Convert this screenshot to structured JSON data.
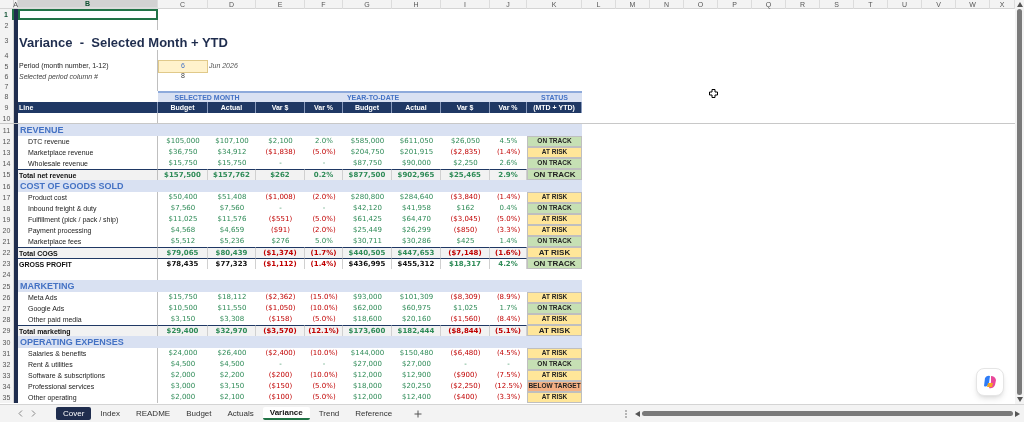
{
  "column_headers": [
    {
      "label": "A",
      "selected": false
    },
    {
      "label": "B",
      "selected": true
    },
    {
      "label": "C",
      "selected": false
    },
    {
      "label": "D",
      "selected": false
    },
    {
      "label": "E",
      "selected": false
    },
    {
      "label": "F",
      "selected": false
    },
    {
      "label": "G",
      "selected": false
    },
    {
      "label": "H",
      "selected": false
    },
    {
      "label": "I",
      "selected": false
    },
    {
      "label": "J",
      "selected": false
    },
    {
      "label": "K",
      "selected": false
    },
    {
      "label": "L",
      "selected": false
    },
    {
      "label": "M",
      "selected": false
    },
    {
      "label": "N",
      "selected": false
    },
    {
      "label": "O",
      "selected": false
    },
    {
      "label": "P",
      "selected": false
    },
    {
      "label": "Q",
      "selected": false
    },
    {
      "label": "R",
      "selected": false
    },
    {
      "label": "S",
      "selected": false
    },
    {
      "label": "T",
      "selected": false
    },
    {
      "label": "U",
      "selected": false
    },
    {
      "label": "V",
      "selected": false
    },
    {
      "label": "W",
      "selected": false
    },
    {
      "label": "X",
      "selected": false
    }
  ],
  "row_headers": [
    {
      "label": "1",
      "selected": true
    },
    {
      "label": "2",
      "selected": false
    },
    {
      "label": "3",
      "selected": false
    },
    {
      "label": "4",
      "selected": false
    },
    {
      "label": "5",
      "selected": false
    },
    {
      "label": "6",
      "selected": false
    },
    {
      "label": "7",
      "selected": false
    },
    {
      "label": "8",
      "selected": false
    },
    {
      "label": "9",
      "selected": false
    },
    {
      "label": "10",
      "selected": false
    },
    {
      "label": "11",
      "selected": false
    },
    {
      "label": "12",
      "selected": false
    },
    {
      "label": "13",
      "selected": false
    },
    {
      "label": "14",
      "selected": false
    },
    {
      "label": "15",
      "selected": false
    },
    {
      "label": "16",
      "selected": false
    },
    {
      "label": "17",
      "selected": false
    },
    {
      "label": "18",
      "selected": false
    },
    {
      "label": "19",
      "selected": false
    },
    {
      "label": "20",
      "selected": false
    },
    {
      "label": "21",
      "selected": false
    },
    {
      "label": "22",
      "selected": false
    },
    {
      "label": "23",
      "selected": false
    },
    {
      "label": "24",
      "selected": false
    },
    {
      "label": "25",
      "selected": false
    },
    {
      "label": "26",
      "selected": false
    },
    {
      "label": "27",
      "selected": false
    },
    {
      "label": "28",
      "selected": false
    },
    {
      "label": "29",
      "selected": false
    },
    {
      "label": "30",
      "selected": false
    },
    {
      "label": "31",
      "selected": false
    },
    {
      "label": "32",
      "selected": false
    },
    {
      "label": "33",
      "selected": false
    },
    {
      "label": "34",
      "selected": false
    },
    {
      "label": "35",
      "selected": false
    }
  ],
  "title": "Variance  -  Selected Month + YTD",
  "period": {
    "label": "Period (month number, 1-12)",
    "value": "6",
    "month": "Jun 2026"
  },
  "selected_column": {
    "label": "Selected period column #",
    "value": "8"
  },
  "group_headers": [
    "SELECTED MONTH",
    "YEAR-TO-DATE",
    "STATUS"
  ],
  "columns": [
    "Line",
    "Budget",
    "Actual",
    "Var $",
    "Var %",
    "Budget",
    "Actual",
    "Var $",
    "Var %",
    "(MTD + YTD)"
  ],
  "rows": [
    {
      "kind": "section",
      "label": "REVENUE"
    },
    {
      "kind": "item",
      "label": "DTC revenue",
      "values": [
        "$105,000",
        "$107,100",
        "$2,100",
        "2.0%",
        "$585,000",
        "$611,050",
        "$26,050",
        "4.5%"
      ],
      "negative": [
        false,
        false,
        false,
        false,
        false,
        false,
        false,
        false
      ],
      "status": {
        "text": "ON TRACK",
        "color": "#c6e0b4"
      }
    },
    {
      "kind": "item",
      "label": "Marketplace revenue",
      "values": [
        "$36,750",
        "$34,912",
        "($1,838)",
        "(5.0%)",
        "$204,750",
        "$201,915",
        "($2,835)",
        "(1.4%)"
      ],
      "negative": [
        false,
        false,
        true,
        true,
        false,
        false,
        true,
        true
      ],
      "status": {
        "text": "AT RISK",
        "color": "#ffe699"
      }
    },
    {
      "kind": "item",
      "label": "Wholesale revenue",
      "values": [
        "$15,750",
        "$15,750",
        "-",
        "-",
        "$87,750",
        "$90,000",
        "$2,250",
        "2.6%"
      ],
      "negative": [
        false,
        false,
        false,
        false,
        false,
        false,
        false,
        false
      ],
      "status": {
        "text": "ON TRACK",
        "color": "#c6e0b4"
      }
    },
    {
      "kind": "total",
      "label": "Total net revenue",
      "values": [
        "$157,500",
        "$157,762",
        "$262",
        "0.2%",
        "$877,500",
        "$902,965",
        "$25,465",
        "2.9%"
      ],
      "negative": [
        false,
        false,
        false,
        false,
        false,
        false,
        false,
        false
      ],
      "status": {
        "text": "ON TRACK",
        "color": "#c6e0b4"
      }
    },
    {
      "kind": "section",
      "label": "COST OF GOODS SOLD"
    },
    {
      "kind": "item",
      "label": "Product cost",
      "values": [
        "$50,400",
        "$51,408",
        "($1,008)",
        "(2.0%)",
        "$280,800",
        "$284,640",
        "($3,840)",
        "(1.4%)"
      ],
      "negative": [
        false,
        false,
        true,
        true,
        false,
        false,
        true,
        true
      ],
      "status": {
        "text": "AT RISK",
        "color": "#ffe699"
      }
    },
    {
      "kind": "item",
      "label": "Inbound freight & duty",
      "values": [
        "$7,560",
        "$7,560",
        "-",
        "-",
        "$42,120",
        "$41,958",
        "$162",
        "0.4%"
      ],
      "negative": [
        false,
        false,
        false,
        false,
        false,
        false,
        false,
        false
      ],
      "status": {
        "text": "ON TRACK",
        "color": "#c6e0b4"
      }
    },
    {
      "kind": "item",
      "label": "Fulfillment (pick / pack / ship)",
      "values": [
        "$11,025",
        "$11,576",
        "($551)",
        "(5.0%)",
        "$61,425",
        "$64,470",
        "($3,045)",
        "(5.0%)"
      ],
      "negative": [
        false,
        false,
        true,
        true,
        false,
        false,
        true,
        true
      ],
      "status": {
        "text": "AT RISK",
        "color": "#ffe699"
      }
    },
    {
      "kind": "item",
      "label": "Payment processing",
      "values": [
        "$4,568",
        "$4,659",
        "($91)",
        "(2.0%)",
        "$25,449",
        "$26,299",
        "($850)",
        "(3.3%)"
      ],
      "negative": [
        false,
        false,
        true,
        true,
        false,
        false,
        true,
        true
      ],
      "status": {
        "text": "AT RISK",
        "color": "#ffe699"
      }
    },
    {
      "kind": "item",
      "label": "Marketplace fees",
      "values": [
        "$5,512",
        "$5,236",
        "$276",
        "5.0%",
        "$30,711",
        "$30,286",
        "$425",
        "1.4%"
      ],
      "negative": [
        false,
        false,
        false,
        false,
        false,
        false,
        false,
        false
      ],
      "status": {
        "text": "ON TRACK",
        "color": "#c6e0b4"
      }
    },
    {
      "kind": "total",
      "label": "Total COGS",
      "values": [
        "$79,065",
        "$80,439",
        "($1,374)",
        "(1.7%)",
        "$440,505",
        "$447,653",
        "($7,148)",
        "(1.6%)"
      ],
      "negative": [
        false,
        false,
        true,
        true,
        false,
        false,
        true,
        true
      ],
      "status": {
        "text": "AT RISK",
        "color": "#ffe699"
      }
    },
    {
      "kind": "profit",
      "label": "GROSS PROFIT",
      "values": [
        "$78,435",
        "$77,323",
        "($1,112)",
        "(1.4%)",
        "$436,995",
        "$455,312",
        "$18,317",
        "4.2%"
      ],
      "negative": [
        false,
        false,
        true,
        true,
        false,
        false,
        false,
        false
      ],
      "status": {
        "text": "ON TRACK",
        "color": "#c6e0b4"
      }
    },
    {
      "kind": "blank"
    },
    {
      "kind": "section",
      "label": "MARKETING"
    },
    {
      "kind": "item",
      "label": "Meta Ads",
      "values": [
        "$15,750",
        "$18,112",
        "($2,362)",
        "(15.0%)",
        "$93,000",
        "$101,309",
        "($8,309)",
        "(8.9%)"
      ],
      "negative": [
        false,
        false,
        true,
        true,
        false,
        false,
        true,
        true
      ],
      "status": {
        "text": "AT RISK",
        "color": "#ffe699"
      }
    },
    {
      "kind": "item",
      "label": "Google Ads",
      "values": [
        "$10,500",
        "$11,550",
        "($1,050)",
        "(10.0%)",
        "$62,000",
        "$60,975",
        "$1,025",
        "1.7%"
      ],
      "negative": [
        false,
        false,
        true,
        true,
        false,
        false,
        false,
        false
      ],
      "status": {
        "text": "ON TRACK",
        "color": "#c6e0b4"
      }
    },
    {
      "kind": "item",
      "label": "Other paid media",
      "values": [
        "$3,150",
        "$3,308",
        "($158)",
        "(5.0%)",
        "$18,600",
        "$20,160",
        "($1,560)",
        "(8.4%)"
      ],
      "negative": [
        false,
        false,
        true,
        true,
        false,
        false,
        true,
        true
      ],
      "status": {
        "text": "AT RISK",
        "color": "#ffe699"
      }
    },
    {
      "kind": "total",
      "label": "Total marketing",
      "values": [
        "$29,400",
        "$32,970",
        "($3,570)",
        "(12.1%)",
        "$173,600",
        "$182,444",
        "($8,844)",
        "(5.1%)"
      ],
      "negative": [
        false,
        false,
        true,
        true,
        false,
        false,
        true,
        true
      ],
      "status": {
        "text": "AT RISK",
        "color": "#ffe699"
      }
    },
    {
      "kind": "section",
      "label": "OPERATING EXPENSES"
    },
    {
      "kind": "item",
      "label": "Salaries & benefits",
      "values": [
        "$24,000",
        "$26,400",
        "($2,400)",
        "(10.0%)",
        "$144,000",
        "$150,480",
        "($6,480)",
        "(4.5%)"
      ],
      "negative": [
        false,
        false,
        true,
        true,
        false,
        false,
        true,
        true
      ],
      "status": {
        "text": "AT RISK",
        "color": "#ffe699"
      }
    },
    {
      "kind": "item",
      "label": "Rent & utilities",
      "values": [
        "$4,500",
        "$4,500",
        "-",
        "-",
        "$27,000",
        "$27,000",
        "-",
        "-"
      ],
      "negative": [
        false,
        false,
        false,
        false,
        false,
        false,
        false,
        false
      ],
      "status": {
        "text": "ON TRACK",
        "color": "#c6e0b4"
      }
    },
    {
      "kind": "item",
      "label": "Software & subscriptions",
      "values": [
        "$2,000",
        "$2,200",
        "($200)",
        "(10.0%)",
        "$12,000",
        "$12,900",
        "($900)",
        "(7.5%)"
      ],
      "negative": [
        false,
        false,
        true,
        true,
        false,
        false,
        true,
        true
      ],
      "status": {
        "text": "AT RISK",
        "color": "#ffe699"
      }
    },
    {
      "kind": "item",
      "label": "Professional services",
      "values": [
        "$3,000",
        "$3,150",
        "($150)",
        "(5.0%)",
        "$18,000",
        "$20,250",
        "($2,250)",
        "(12.5%)"
      ],
      "negative": [
        false,
        false,
        true,
        true,
        false,
        false,
        true,
        true
      ],
      "status": {
        "text": "BELOW TARGET",
        "color": "#f4b084"
      }
    },
    {
      "kind": "item",
      "label": "Other operating",
      "values": [
        "$2,000",
        "$2,100",
        "($100)",
        "(5.0%)",
        "$12,000",
        "$12,400",
        "($400)",
        "(3.3%)"
      ],
      "negative": [
        false,
        false,
        true,
        true,
        false,
        false,
        true,
        true
      ],
      "status": {
        "text": "AT RISK",
        "color": "#ffe699"
      }
    }
  ],
  "sheet_tabs": [
    {
      "label": "Cover",
      "selected": false,
      "color": "#1f2d4e"
    },
    {
      "label": "Index",
      "selected": false
    },
    {
      "label": "README",
      "selected": false
    },
    {
      "label": "Budget",
      "selected": false
    },
    {
      "label": "Actuals",
      "selected": false
    },
    {
      "label": "Variance",
      "selected": true
    },
    {
      "label": "Trend",
      "selected": false
    },
    {
      "label": "Reference",
      "selected": false
    }
  ]
}
